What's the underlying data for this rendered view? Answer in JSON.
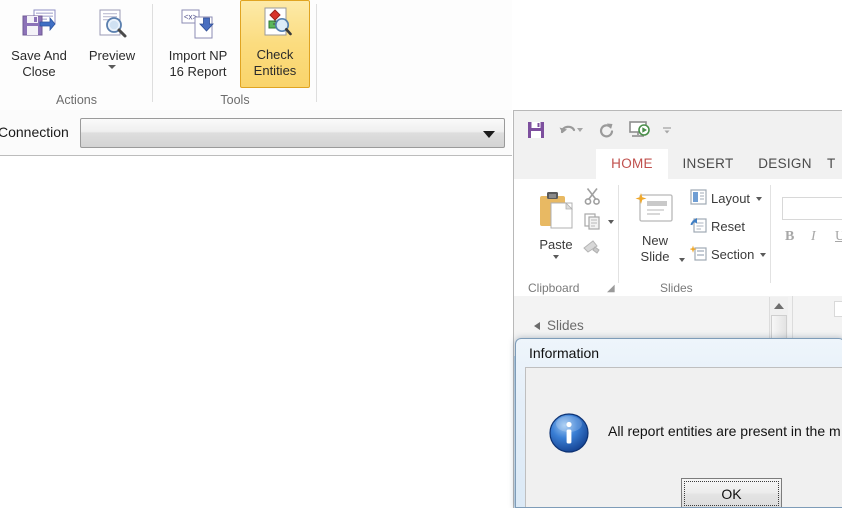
{
  "host": {
    "ribbon": {
      "groups": [
        {
          "name": "actions",
          "label": "Actions",
          "buttons": [
            {
              "label": "Save And\nClose",
              "icon": "save-and-close-icon",
              "has_dropdown": false
            },
            {
              "label": "Preview",
              "icon": "preview-magnifier-icon",
              "has_dropdown": true
            }
          ]
        },
        {
          "name": "tools",
          "label": "Tools",
          "buttons": [
            {
              "label": "Import NP\n16 Report",
              "icon": "import-report-icon",
              "has_dropdown": false
            },
            {
              "label": "Check\nEntities",
              "icon": "check-entities-icon",
              "has_dropdown": false,
              "highlighted": true
            }
          ]
        }
      ]
    },
    "connection": {
      "label": "Connection",
      "value": "",
      "placeholder": "",
      "dropdown_icon": "chevron-down-icon"
    }
  },
  "powerpoint": {
    "quick_access": [
      {
        "name": "save-icon",
        "label": "Save"
      },
      {
        "name": "undo-icon",
        "label": "Undo"
      },
      {
        "name": "redo-icon",
        "label": "Redo"
      },
      {
        "name": "start-slideshow-icon",
        "label": "Start From Beginning"
      },
      {
        "name": "customize-qat-icon",
        "label": "Customize Quick Access Toolbar"
      }
    ],
    "tabs": [
      {
        "label": "HOME",
        "active": true
      },
      {
        "label": "INSERT",
        "active": false
      },
      {
        "label": "DESIGN",
        "active": false
      },
      {
        "label": "T",
        "active": false
      }
    ],
    "ribbon_groups": [
      {
        "name": "clipboard",
        "label": "Clipboard",
        "items": [
          {
            "label": "Paste",
            "icon": "paste-clipboard-icon",
            "has_dropdown": true
          },
          {
            "label": "",
            "icon": "cut-scissors-icon",
            "has_dropdown": false
          },
          {
            "label": "",
            "icon": "copy-icon",
            "has_dropdown": true
          },
          {
            "label": "",
            "icon": "format-painter-icon",
            "has_dropdown": false
          }
        ],
        "dialog_launcher": "dialog-launcher-icon"
      },
      {
        "name": "slides",
        "label": "Slides",
        "items": [
          {
            "label": "New\nSlide",
            "icon": "new-slide-icon",
            "has_dropdown": true
          },
          {
            "label": "Layout",
            "icon": "layout-icon",
            "has_dropdown": true
          },
          {
            "label": "Reset",
            "icon": "reset-icon",
            "has_dropdown": false
          },
          {
            "label": "Section",
            "icon": "section-icon",
            "has_dropdown": true
          }
        ]
      },
      {
        "name": "font",
        "label": "",
        "items": [
          {
            "label": "B",
            "icon": "bold-icon",
            "has_dropdown": false
          },
          {
            "label": "I",
            "icon": "italic-icon",
            "has_dropdown": false
          },
          {
            "label": "U",
            "icon": "underline-icon",
            "has_dropdown": false
          }
        ],
        "font_name_value": ""
      }
    ],
    "slides_panel": {
      "header": "Slides",
      "collapse_icon": "triangle-collapse-icon",
      "scroll_up_icon": "scroll-up-arrow-icon"
    }
  },
  "dialog": {
    "title": "Information",
    "icon": "information-icon",
    "message": "All report entities are present in the m",
    "buttons": [
      {
        "label": "OK",
        "focused": true
      }
    ]
  },
  "colors": {
    "highlight_gold": "#fad46b",
    "highlight_gold_border": "#e0a422",
    "tab_active_text": "#c0504d",
    "ppt_save_purple": "#7d4f9e",
    "info_blue": "#1b62c4"
  }
}
